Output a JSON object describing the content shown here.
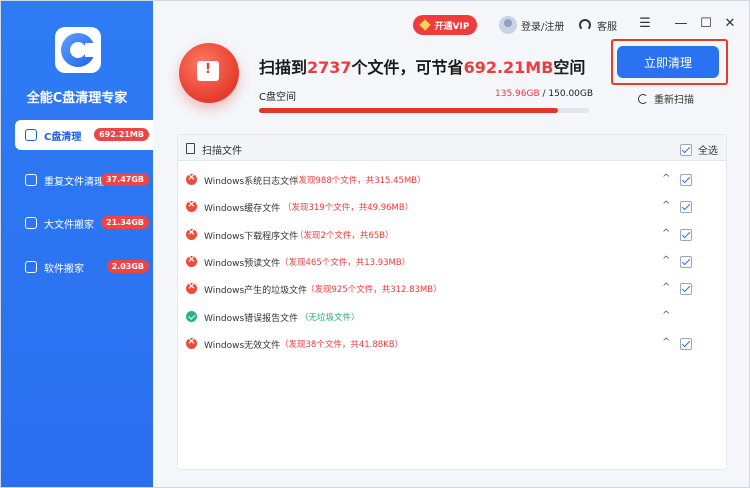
{
  "app": {
    "title": "全能C盘清理专家"
  },
  "sidebar": {
    "items": [
      {
        "label": "C盘清理",
        "badge": "692.21MB",
        "active": true,
        "icon": "disk-icon"
      },
      {
        "label": "重复文件清理",
        "badge": "37.47GB",
        "active": false,
        "icon": "duplicate-icon"
      },
      {
        "label": "大文件搬家",
        "badge": "21.34GB",
        "active": false,
        "icon": "move-file-icon"
      },
      {
        "label": "软件搬家",
        "badge": "2.03GB",
        "active": false,
        "icon": "software-icon"
      }
    ]
  },
  "topbar": {
    "vip_label": "开通VIP",
    "login_label": "登录/注册",
    "service_label": "客服",
    "menu_icon": "menu-icon",
    "minimize_icon": "minimize-icon",
    "maximize_icon": "maximize-icon",
    "close_icon": "close-icon"
  },
  "summary": {
    "prefix": "扫描到",
    "file_count": "2737",
    "middle": "个文件，可节省",
    "saving": "692.21MB",
    "suffix": "空间",
    "disk_label": "C盘空间",
    "used": "135.96GB",
    "separator": " / ",
    "total": "150.00GB",
    "used_fraction": 0.906
  },
  "actions": {
    "clean_label": "立即清理",
    "rescan_label": "重新扫描"
  },
  "panel": {
    "title": "扫描文件",
    "select_all_label": "全选",
    "rows": [
      {
        "name": "Windows系统日志文件",
        "detail": "（发现988个文件，共315.45MB）",
        "status": "error",
        "checked": true
      },
      {
        "name": "Windows缓存文件",
        "detail": "（发现319个文件，共49.96MB）",
        "status": "error",
        "checked": true
      },
      {
        "name": "Windows下载程序文件",
        "detail": "（发现2个文件，共65B）",
        "status": "error",
        "checked": true
      },
      {
        "name": "Windows预读文件",
        "detail": "（发现465个文件，共13.93MB）",
        "status": "error",
        "checked": true
      },
      {
        "name": "Windows产生的垃圾文件",
        "detail": "（发现925个文件，共312.83MB）",
        "status": "error",
        "checked": true
      },
      {
        "name": "Windows错误报告文件",
        "detail": "（无垃圾文件）",
        "status": "ok",
        "checked": false
      },
      {
        "name": "Windows无效文件",
        "detail": "（发现38个文件，共41.88KB）",
        "status": "error",
        "checked": true
      }
    ]
  },
  "colors": {
    "accent": "#2b72f0",
    "danger": "#ef3b3b",
    "success": "#22b07f"
  }
}
